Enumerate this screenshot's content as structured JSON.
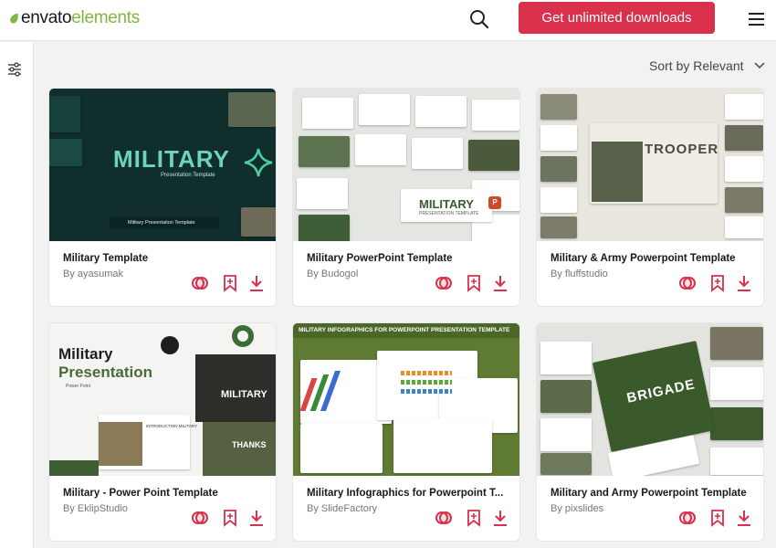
{
  "header": {
    "logo_bold": "envato",
    "logo_light": "elements",
    "cta_label": "Get unlimited downloads",
    "search_icon": "search-icon",
    "menu_icon": "hamburger-menu-icon"
  },
  "sidebar": {
    "filter_icon": "filter-sliders-icon"
  },
  "sort": {
    "label": "Sort by Relevant"
  },
  "colors": {
    "brand_green": "#82b541",
    "cta_red": "#d9304b",
    "olive": "#4a6b35",
    "dark_teal": "#0f2e2c"
  },
  "cards": [
    {
      "title": "Military Template",
      "author": "By ayasumak",
      "thumb": {
        "headline": "MILITARY",
        "subline": "Presentation Template",
        "caption": "Military Presentation Template"
      }
    },
    {
      "title": "Military PowerPoint Template",
      "author": "By Budogol",
      "thumb": {
        "headline": "MILITARY",
        "subline": "PRESENTATION TEMPLATE"
      }
    },
    {
      "title": "Military & Army Powerpoint Template",
      "author": "By fluffstudio",
      "thumb": {
        "headline": "TROOPER"
      }
    },
    {
      "title": "Military - Power Point Template",
      "author": "By EklipStudio",
      "thumb": {
        "line1": "Military",
        "line2": "Presentation",
        "small": "Power Point",
        "side": "MILITARY",
        "tag": "THANKS",
        "intro": "INTRODUCTION MILITARY"
      }
    },
    {
      "title": "Military Infographics for Powerpoint T...",
      "author": "By SlideFactory",
      "thumb": {
        "banner": "MILITARY INFOGRAPHICS FOR POWERPOINT PRESENTATION TEMPLATE"
      }
    },
    {
      "title": "Military and Army Powerpoint Template",
      "author": "By pixslides",
      "thumb": {
        "headline": "BRIGADE"
      }
    }
  ]
}
